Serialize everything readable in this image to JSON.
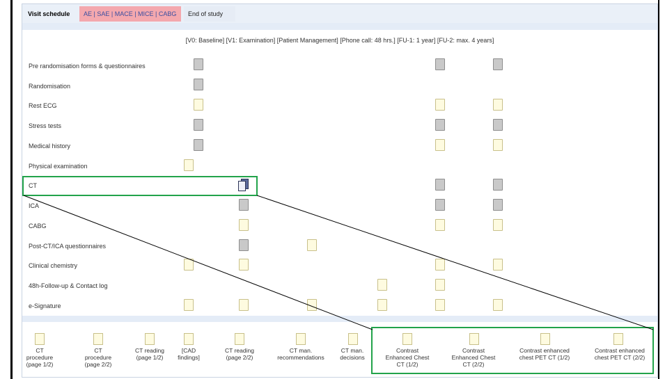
{
  "tabs": {
    "visit_schedule": "Visit schedule",
    "ae": "AE | SAE | MACE | MICE | CABG",
    "end_of_study": "End of study"
  },
  "visit_header": "[V0: Baseline]  [V1: Examination]  [Patient Management]  [Phone call: 48 hrs.]  [FU-1: 1 year]  [FU-2: max. 4 years]",
  "rows": [
    "Pre randomisation forms & questionnaires",
    "Randomisation",
    "Rest ECG",
    "Stress tests",
    "Medical history",
    "Physical examination",
    "CT",
    "ICA",
    "CABG",
    "Post-CT/ICA questionnaires",
    "Clinical chemistry",
    "48h-Follow-up & Contact log",
    "e-Signature"
  ],
  "forms": [
    {
      "l1": "CT",
      "l2": "procedure",
      "l3": "(page 1/2)"
    },
    {
      "l1": "CT",
      "l2": "procedure",
      "l3": "(page 2/2)"
    },
    {
      "l1": "CT reading",
      "l2": "(page 1/2)",
      "l3": ""
    },
    {
      "l1": "[CAD",
      "l2": "findings]",
      "l3": ""
    },
    {
      "l1": "CT reading",
      "l2": "(page 2/2)",
      "l3": ""
    },
    {
      "l1": "CT man.",
      "l2": "recommendations",
      "l3": ""
    },
    {
      "l1": "CT man.",
      "l2": "decisions",
      "l3": ""
    },
    {
      "l1": "Contrast",
      "l2": "Enhanced Chest",
      "l3": "CT (1/2)"
    },
    {
      "l1": "Contrast",
      "l2": "Enhanced Chest",
      "l3": "CT (2/2)"
    },
    {
      "l1": "Contrast enhanced",
      "l2": "chest PET CT (1/2)",
      "l3": ""
    },
    {
      "l1": "Contrast enhanced",
      "l2": "chest PET CT (2/2)",
      "l3": ""
    }
  ],
  "colors": {
    "highlight": "#22a34a",
    "ae_tab": "#f4a8ae",
    "tab_band": "#eaf0f8"
  },
  "icons": {
    "blank_form": "page-icon",
    "completed_form": "grey-page-icon",
    "selected_form": "stacked-pages-icon"
  }
}
